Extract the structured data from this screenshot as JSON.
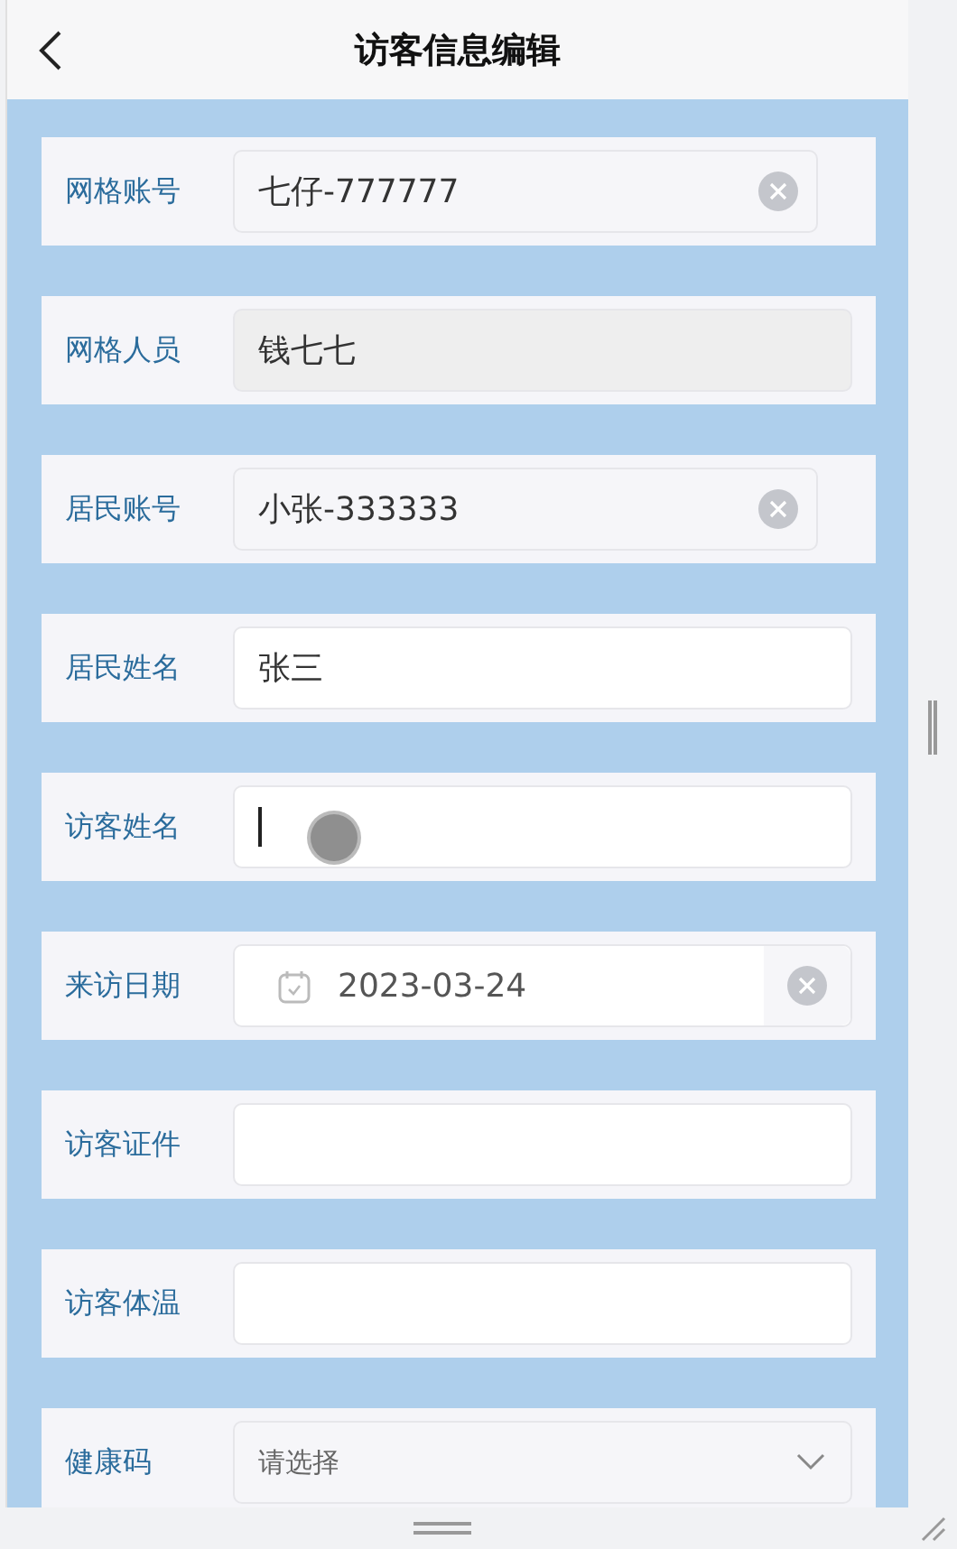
{
  "header": {
    "title": "访客信息编辑"
  },
  "fields": [
    {
      "label": "网格账号",
      "kind": "clearable",
      "value": "七仔-777777",
      "focused": false
    },
    {
      "label": "网格人员",
      "kind": "readonly",
      "value": "钱七七",
      "focused": false
    },
    {
      "label": "居民账号",
      "kind": "clearable",
      "value": "小张-333333",
      "focused": false
    },
    {
      "label": "居民姓名",
      "kind": "text",
      "value": "张三",
      "focused": false
    },
    {
      "label": "访客姓名",
      "kind": "text",
      "focused": true
    },
    {
      "label": "来访日期",
      "kind": "date",
      "value": "2023-03-24",
      "focused": false
    },
    {
      "label": "访客证件",
      "kind": "text",
      "focused": false
    },
    {
      "label": "访客体温",
      "kind": "text",
      "focused": false
    },
    {
      "label": "健康码",
      "kind": "select",
      "placeholder": "请选择",
      "focused": false
    }
  ]
}
